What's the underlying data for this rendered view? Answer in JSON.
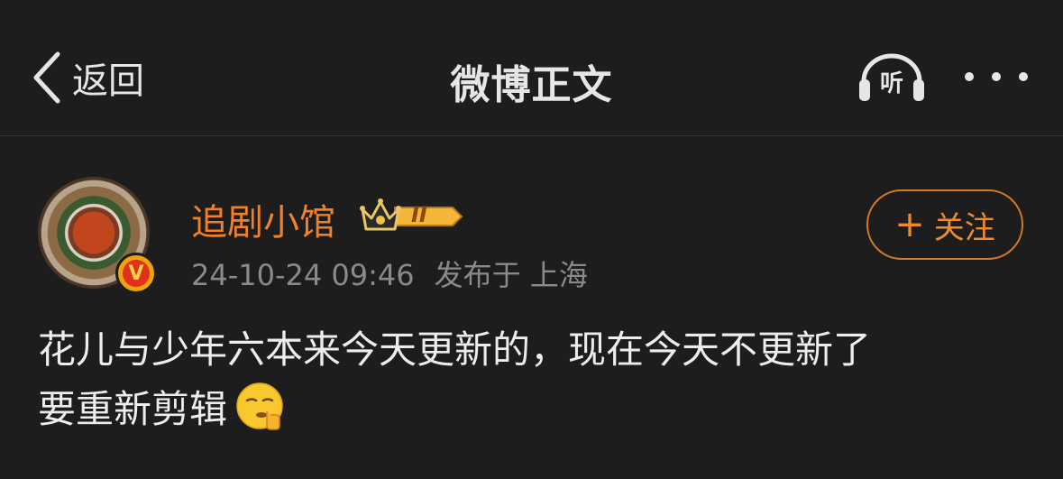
{
  "nav": {
    "back_label": "返回",
    "title": "微博正文",
    "listen_label": "听",
    "icons": {
      "back": "chevron-left-icon",
      "listen": "headphones-icon",
      "more": "more-dots-icon"
    }
  },
  "author": {
    "name": "追剧小馆",
    "timestamp": "24-10-24 09:46",
    "location": "发布于 上海",
    "verified_badge": "V",
    "vip_level": "II",
    "follow_label": "关注"
  },
  "post": {
    "line1": "花儿与少年六本来今天更新的，现在今天不更新了",
    "line2": "要重新剪辑",
    "emoji": "shushing-face-emoji"
  },
  "colors": {
    "background": "#1d1d1d",
    "accent": "#f28028",
    "meta_text": "#8a8a8a",
    "body_text": "#ededed"
  }
}
